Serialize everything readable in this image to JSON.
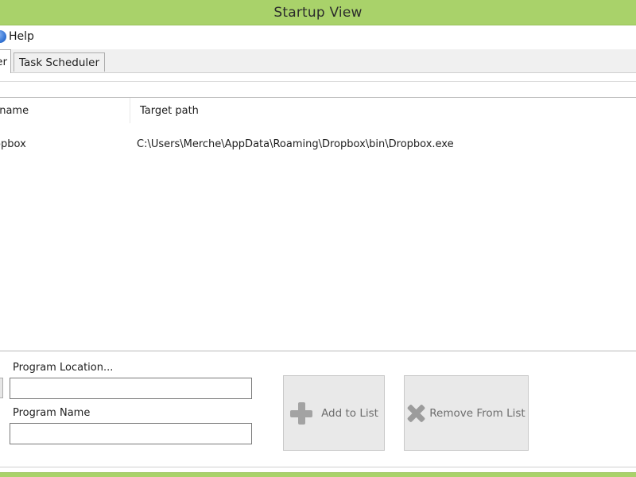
{
  "window": {
    "title": "Startup View"
  },
  "menu": {
    "help_label": "Help",
    "help_icon": "help-globe-icon"
  },
  "tabs": [
    {
      "label": "er",
      "active": true
    },
    {
      "label": "Task Scheduler",
      "active": false
    }
  ],
  "list": {
    "columns": [
      "ilename",
      "Target path"
    ],
    "rows": [
      {
        "name": "ropbox",
        "path": "C:\\Users\\Merche\\AppData\\Roaming\\Dropbox\\bin\\Dropbox.exe"
      }
    ]
  },
  "form": {
    "location_label": "Program Location...",
    "location_value": "",
    "name_label": "Program Name",
    "name_value": ""
  },
  "buttons": {
    "add_label": "Add to List",
    "remove_label": "Remove From List"
  },
  "colors": {
    "accent": "#a9d26a",
    "button_bg": "#e9e9e9"
  }
}
